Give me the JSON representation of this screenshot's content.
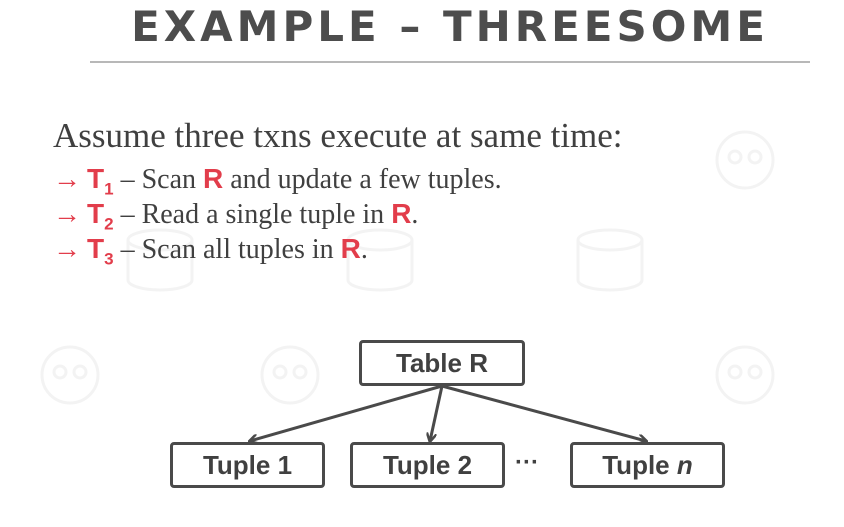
{
  "slide": {
    "title": "EXAMPLE – THREESOME",
    "lead": "Assume three txns execute at same time:",
    "bullets": [
      {
        "txn": "T",
        "sub": "1",
        "pre": " – Scan ",
        "rel": "R",
        "post": " and update a few tuples."
      },
      {
        "txn": "T",
        "sub": "2",
        "pre": " – Read a single tuple in ",
        "rel": "R",
        "post": "."
      },
      {
        "txn": "T",
        "sub": "3",
        "pre": " – Scan all tuples in ",
        "rel": "R",
        "post": "."
      }
    ],
    "arrow": "→"
  },
  "diagram": {
    "root": "Table R",
    "children": [
      "Tuple 1",
      "Tuple 2"
    ],
    "ellipsis": "···",
    "last_prefix": "Tuple ",
    "last_var": "n"
  },
  "colors": {
    "accent": "#e23d4b",
    "text": "#404040",
    "box_border": "#4a4a4a"
  },
  "icons": [
    "database-watermark-icon",
    "skull-watermark-icon"
  ]
}
